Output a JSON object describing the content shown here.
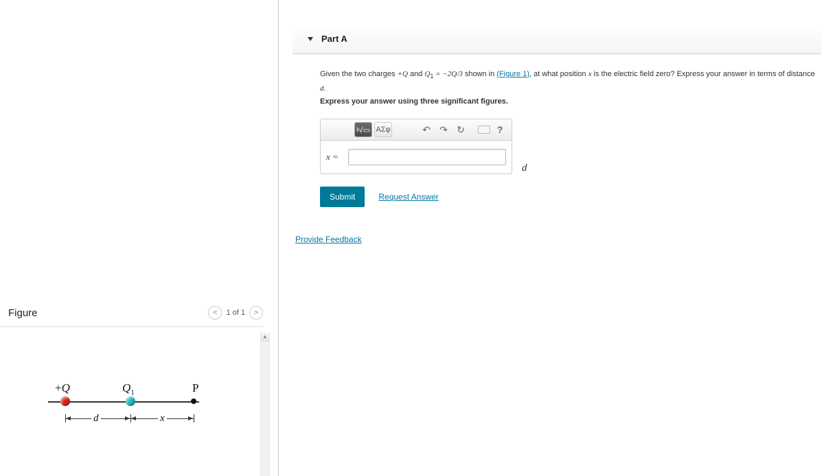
{
  "part": {
    "title": "Part A"
  },
  "question": {
    "intro": "Given the two charges ",
    "q1_sym": "+Q",
    "and": " and ",
    "q2_sym": "Q",
    "q2_sub": "1",
    "eq": " = −2Q/3",
    "shown_in": " shown in ",
    "fig_link": "(Figure 1)",
    "rest": ", at what position ",
    "var": "x",
    "rest2": " is the electric field zero? Express your answer in terms of distance ",
    "dvar": "d",
    "period": ".",
    "instruct": "Express your answer using three significant figures."
  },
  "toolbar": {
    "templates_icon": "▭",
    "root_icon": "ᵡ√▭",
    "greek": "ΑΣφ",
    "undo": "↶",
    "redo": "↷",
    "reset": "↻",
    "keyboard": "⌨",
    "help": "?"
  },
  "answer": {
    "lhs": "x =",
    "value": "",
    "unit": "d"
  },
  "buttons": {
    "submit": "Submit",
    "request": "Request Answer"
  },
  "links": {
    "feedback": "Provide Feedback"
  },
  "figure": {
    "title": "Figure",
    "nav": {
      "prev": "<",
      "counter": "1 of 1",
      "next": ">"
    },
    "labels": {
      "plusQ_pre": "+",
      "plusQ": "Q",
      "Q1": "Q",
      "Q1_sub": "1",
      "P": "P",
      "d": "d",
      "x": "x"
    }
  }
}
